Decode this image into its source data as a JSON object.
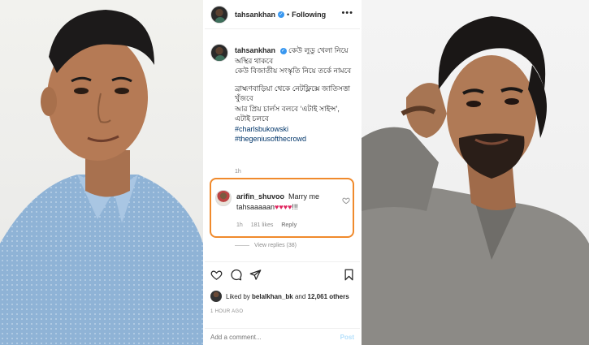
{
  "post": {
    "author": {
      "username": "tahsankhan",
      "verified_mark": "✓",
      "follow_separator": "•",
      "follow_state": "Following"
    },
    "caption": {
      "username": "tahsankhan",
      "line_1": "কেউ লুডু খেলা নিয়ে অস্থির থাকবে",
      "line_2": "কেউ বিজাতীয় সংস্কৃতি নিয়ে তর্কে নামবে",
      "line_3": "ব্রাহ্মণবাড়িয়া থেকে নেটফ্লিক্সে জাতিসত্তা খুঁজবে",
      "line_4": "আর প্রিয় চার্লস বলবে ‘এটাই সাইন্স’,",
      "line_5": "এটাই চলবে",
      "hashtags": [
        "#charlsbukowski",
        "#thegeniusofthecrowd"
      ],
      "time": "1h"
    },
    "highlighted_comment": {
      "username": "arifin_shuvoo",
      "text_part_1": "Marry me",
      "text_part_2": "tahsaaaaan",
      "hearts": "♥♥♥♥",
      "exclaim": "!!!",
      "time": "1h",
      "likes": "181 likes",
      "reply_label": "Reply",
      "highlight_color": "#f08a2c"
    },
    "view_replies": "View replies (38)",
    "liked_by": {
      "prefix": "Liked by",
      "user": "belalkhan_bk",
      "suffix": "and",
      "count": "12,061 others"
    },
    "timestamp": "1 HOUR AGO",
    "add_comment": {
      "placeholder": "Add a comment...",
      "post_label": "Post"
    },
    "icons": {
      "like": "heart-icon",
      "comment": "comment-icon",
      "share": "share-icon",
      "save": "bookmark-icon",
      "more": "more-icon"
    },
    "colors": {
      "accent_link": "#003569",
      "verified": "#3897f0",
      "heart": "#e0245e"
    }
  }
}
